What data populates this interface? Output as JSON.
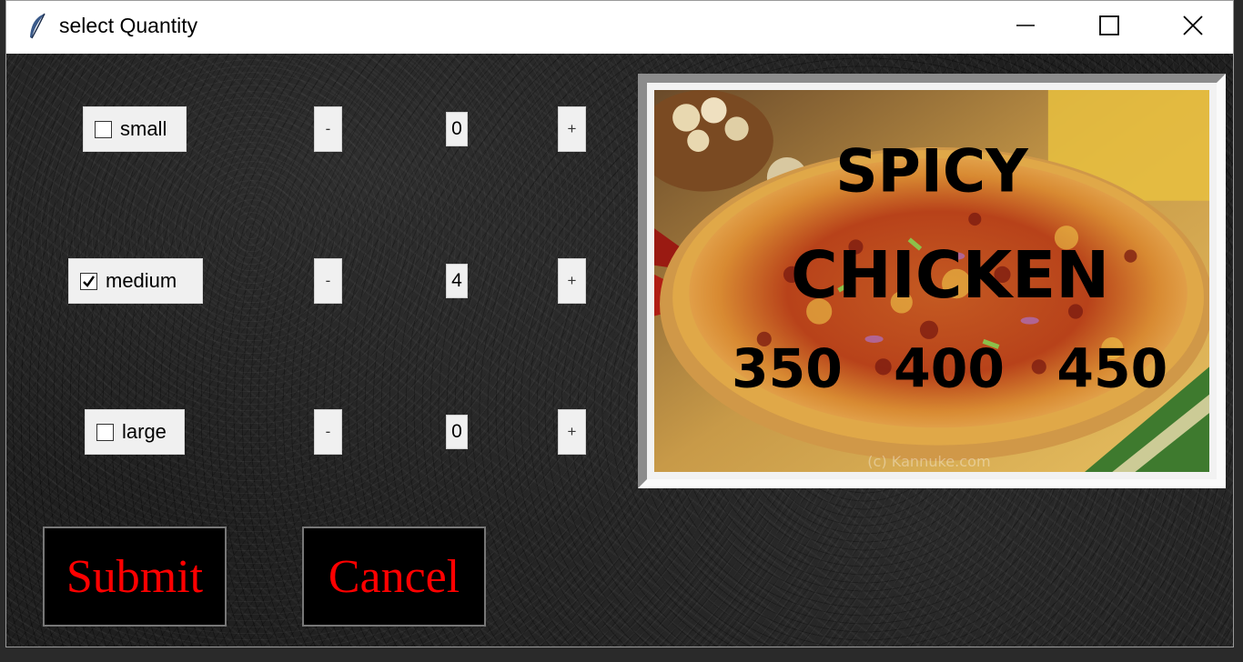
{
  "window": {
    "title": "select Quantity",
    "icons": {
      "app": "feather-icon",
      "minimize": "minimize-icon",
      "maximize": "maximize-icon",
      "close": "close-icon"
    }
  },
  "sizes": [
    {
      "label": "small",
      "checked": false,
      "minus": "-",
      "qty": "0",
      "plus": "+"
    },
    {
      "label": "medium",
      "checked": true,
      "minus": "-",
      "qty": "4",
      "plus": "+"
    },
    {
      "label": "large",
      "checked": false,
      "minus": "-",
      "qty": "0",
      "plus": "+"
    }
  ],
  "buttons": {
    "submit": "Submit",
    "cancel": "Cancel"
  },
  "pizza_image": {
    "line1": "SPICY",
    "line2": "CHICKEN",
    "prices": [
      "350",
      "400",
      "450"
    ],
    "watermark": "(c) Kannuke.com"
  },
  "colors": {
    "button_text": "#ff0000",
    "button_bg": "#000000"
  }
}
